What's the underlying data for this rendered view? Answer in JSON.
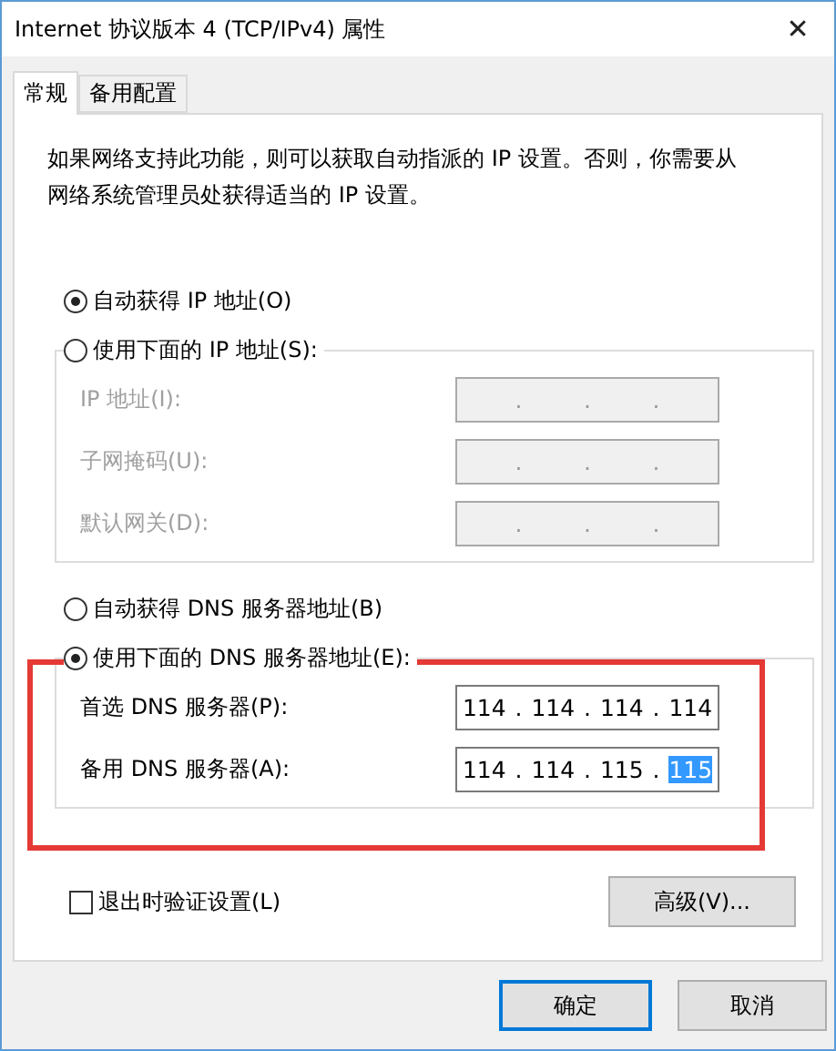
{
  "window": {
    "title": "Internet 协议版本 4 (TCP/IPv4) 属性",
    "close": "✕"
  },
  "tabs": [
    {
      "label": "常规",
      "selected": true
    },
    {
      "label": "备用配置",
      "selected": false
    }
  ],
  "description": "如果网络支持此功能，则可以获取自动指派的 IP 设置。否则，你需要从网络系统管理员处获得适当的 IP 设置。",
  "ip": {
    "options": [
      {
        "label": "自动获得 IP 地址(O)",
        "selected": true
      },
      {
        "label": "使用下面的 IP 地址(S):",
        "selected": false
      }
    ],
    "fields": [
      {
        "label": "IP 地址(I):",
        "disabled": true,
        "separators": [
          ".",
          ".",
          "."
        ]
      },
      {
        "label": "子网掩码(U):",
        "disabled": true,
        "separators": [
          ".",
          ".",
          "."
        ]
      },
      {
        "label": "默认网关(D):",
        "disabled": true,
        "separators": [
          ".",
          ".",
          "."
        ]
      }
    ]
  },
  "dns": {
    "highlighted": true,
    "options": [
      {
        "label": "自动获得 DNS 服务器地址(B)",
        "selected": false
      },
      {
        "label": "使用下面的 DNS 服务器地址(E):",
        "selected": true
      }
    ],
    "fields": [
      {
        "label": "首选 DNS 服务器(P):",
        "disabled": false,
        "separators": [
          ".",
          ".",
          "."
        ],
        "octets": [
          {
            "text": "114",
            "selected": false
          },
          {
            "text": "114",
            "selected": false
          },
          {
            "text": "114",
            "selected": false
          },
          {
            "text": "114",
            "selected": false
          }
        ]
      },
      {
        "label": "备用 DNS 服务器(A):",
        "disabled": false,
        "separators": [
          ".",
          ".",
          "."
        ],
        "octets": [
          {
            "text": "114",
            "selected": false
          },
          {
            "text": "114",
            "selected": false
          },
          {
            "text": "115",
            "selected": false
          },
          {
            "text": "115",
            "selected": true
          }
        ]
      }
    ]
  },
  "validate": {
    "label": "退出时验证设置(L)",
    "checked": false
  },
  "advanced_button": "高级(V)...",
  "buttons": [
    {
      "label": "确定",
      "default": true
    },
    {
      "label": "取消",
      "default": false
    }
  ]
}
